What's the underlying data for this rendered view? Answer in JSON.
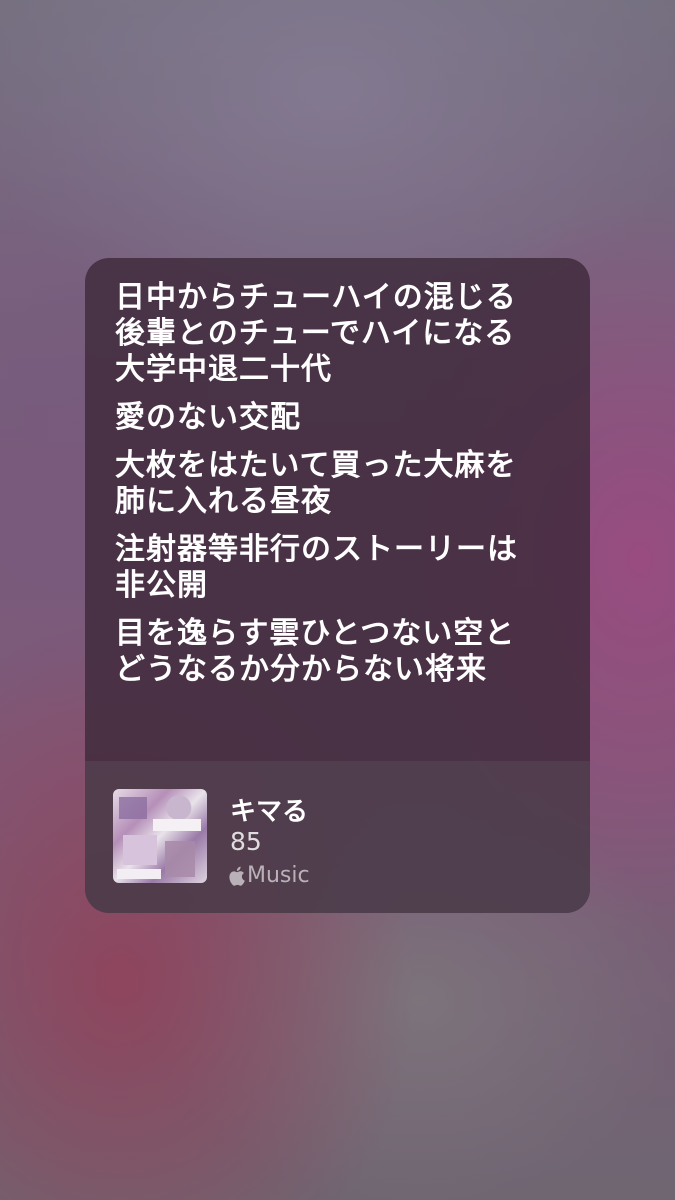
{
  "lyrics": [
    [
      "日中からチューハイの混じる",
      "後輩とのチューでハイになる",
      "大学中退二十代"
    ],
    [
      "愛のない交配"
    ],
    [
      "大枚をはたいて買った大麻を",
      "肺に入れる昼夜"
    ],
    [
      "注射器等非行のストーリーは",
      "非公開"
    ],
    [
      "目を逸らす雲ひとつない空と",
      "どうなるか分からない将来"
    ]
  ],
  "track": {
    "title": "キマる",
    "artist": "85",
    "service": "Music",
    "service_icon": "apple-logo-icon"
  },
  "colors": {
    "card_background": "#3e2a3a",
    "text": "#ffffff"
  }
}
